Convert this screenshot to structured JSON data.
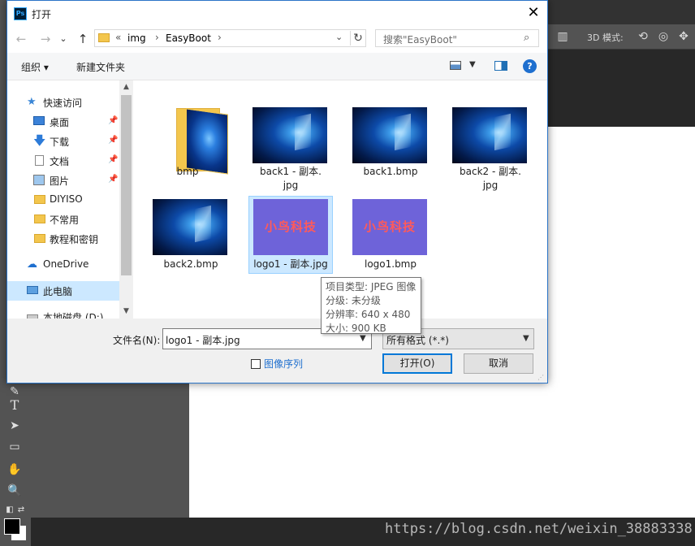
{
  "dialog": {
    "title": "打开",
    "app_badge": "Ps",
    "close_glyph": "✕"
  },
  "nav": {
    "back": "←",
    "forward": "→",
    "recent": "⌄",
    "up": "↑",
    "breadcrumb_prefix": "«",
    "path": [
      "img",
      "EasyBoot"
    ],
    "search_placeholder": "搜索\"EasyBoot\""
  },
  "command_bar": {
    "organize": "组织 ▾",
    "new_folder": "新建文件夹",
    "help": "?"
  },
  "sidebar": {
    "items": [
      {
        "label": "快速访问",
        "icon": "star-icon",
        "pinned": false
      },
      {
        "label": "桌面",
        "icon": "desktop-icon",
        "pinned": true
      },
      {
        "label": "下载",
        "icon": "download-icon",
        "pinned": true
      },
      {
        "label": "文档",
        "icon": "document-icon",
        "pinned": true
      },
      {
        "label": "图片",
        "icon": "pictures-icon",
        "pinned": true
      },
      {
        "label": "DIYISO",
        "icon": "folder-icon",
        "pinned": false
      },
      {
        "label": "不常用",
        "icon": "folder-icon",
        "pinned": false
      },
      {
        "label": "教程和密钥",
        "icon": "folder-icon",
        "pinned": false
      },
      {
        "label": "OneDrive",
        "icon": "cloud-icon",
        "pinned": false
      },
      {
        "label": "此电脑",
        "icon": "computer-icon",
        "pinned": false,
        "selected": true
      },
      {
        "label": "本地磁盘 (D:)",
        "icon": "drive-icon",
        "pinned": false
      }
    ]
  },
  "files": [
    {
      "name": "bmp",
      "line2": "",
      "kind": "folder"
    },
    {
      "name": "back1 - 副本.",
      "line2": "jpg",
      "kind": "windows-wallpaper"
    },
    {
      "name": "back1.bmp",
      "line2": "",
      "kind": "windows-wallpaper"
    },
    {
      "name": "back2 - 副本.",
      "line2": "jpg",
      "kind": "windows-wallpaper"
    },
    {
      "name": "back2.bmp",
      "line2": "",
      "kind": "windows-wallpaper"
    },
    {
      "name": "logo1 - 副本.jpg",
      "line2": "",
      "kind": "logo",
      "selected": true
    },
    {
      "name": "logo1.bmp",
      "line2": "",
      "kind": "logo"
    }
  ],
  "logo_text": "小鸟科技",
  "tooltip": {
    "lines": [
      "项目类型: JPEG 图像",
      "分级: 未分级",
      "分辨率: 640 x 480",
      "大小: 900 KB"
    ]
  },
  "bottom": {
    "filename_label": "文件名(N):",
    "filename_value": "logo1 - 副本.jpg",
    "filetype_value": "所有格式 (*.*)",
    "image_sequence_label": "图像序列",
    "open_button": "打开(O)",
    "cancel_button": "取消"
  },
  "photoshop": {
    "mode_label": "3D 模式:",
    "watermark": "https://blog.csdn.net/weixin_38883338"
  },
  "colors": {
    "accent": "#0078d7",
    "selection": "#cce8ff",
    "logo_bg": "#6e63d9",
    "logo_text": "#ff5a5a"
  }
}
